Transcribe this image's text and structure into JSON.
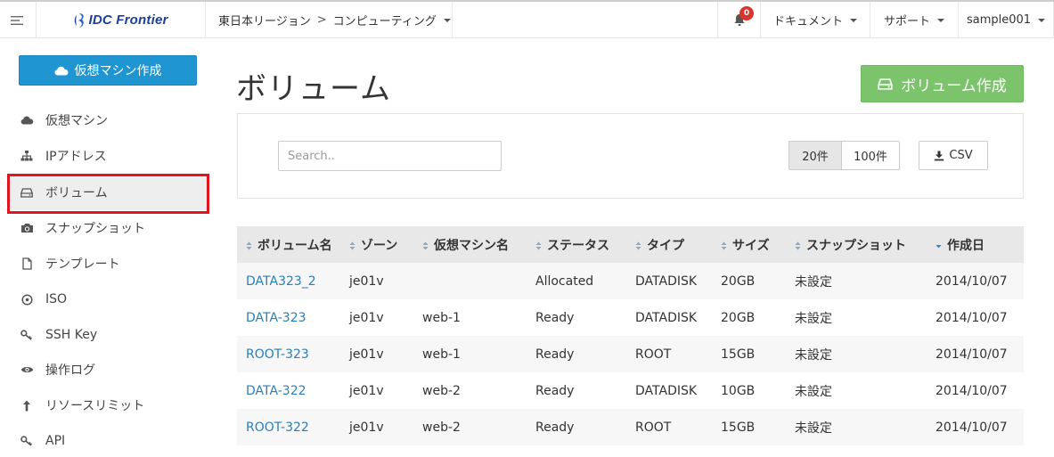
{
  "header": {
    "logo_text": "IDC Frontier",
    "region": "東日本リージョン",
    "breadcrumb_sep": ">",
    "service": "コンピューティング",
    "notification_count": "0",
    "documents": "ドキュメント",
    "support": "サポート",
    "user": "sample001"
  },
  "sidebar": {
    "create_vm_label": "仮想マシン作成",
    "items": [
      {
        "label": "仮想マシン",
        "icon": "cloud-icon"
      },
      {
        "label": "IPアドレス",
        "icon": "network-icon"
      },
      {
        "label": "ボリューム",
        "icon": "drive-icon"
      },
      {
        "label": "スナップショット",
        "icon": "camera-icon"
      },
      {
        "label": "テンプレート",
        "icon": "file-icon"
      },
      {
        "label": "ISO",
        "icon": "disc-icon"
      },
      {
        "label": "SSH Key",
        "icon": "key-icon"
      },
      {
        "label": "操作ログ",
        "icon": "eye-icon"
      },
      {
        "label": "リソースリミット",
        "icon": "upload-icon"
      },
      {
        "label": "API",
        "icon": "key-icon"
      }
    ],
    "active_index": 2
  },
  "main": {
    "title": "ボリューム",
    "create_volume_label": "ボリューム作成",
    "search_placeholder": "Search..",
    "page_size_20": "20件",
    "page_size_100": "100件",
    "csv_label": "CSV"
  },
  "table": {
    "headers": [
      "ボリューム名",
      "ゾーン",
      "仮想マシン名",
      "ステータス",
      "タイプ",
      "サイズ",
      "スナップショット",
      "作成日"
    ],
    "rows": [
      {
        "name": "DATA323_2",
        "zone": "je01v",
        "vm": "",
        "status": "Allocated",
        "type": "DATADISK",
        "size": "20GB",
        "snapshot": "未設定",
        "created": "2014/10/07"
      },
      {
        "name": "DATA-323",
        "zone": "je01v",
        "vm": "web-1",
        "status": "Ready",
        "type": "DATADISK",
        "size": "20GB",
        "snapshot": "未設定",
        "created": "2014/10/07"
      },
      {
        "name": "ROOT-323",
        "zone": "je01v",
        "vm": "web-1",
        "status": "Ready",
        "type": "ROOT",
        "size": "15GB",
        "snapshot": "未設定",
        "created": "2014/10/07"
      },
      {
        "name": "DATA-322",
        "zone": "je01v",
        "vm": "web-2",
        "status": "Ready",
        "type": "DATADISK",
        "size": "10GB",
        "snapshot": "未設定",
        "created": "2014/10/07"
      },
      {
        "name": "ROOT-322",
        "zone": "je01v",
        "vm": "web-2",
        "status": "Ready",
        "type": "ROOT",
        "size": "15GB",
        "snapshot": "未設定",
        "created": "2014/10/07"
      }
    ]
  },
  "colors": {
    "primary_blue": "#1f95d1",
    "create_green": "#7bc46c",
    "link_blue": "#2a7fb8",
    "ready_green": "#3c7a2b",
    "alloc_gray": "#aaaaaa",
    "highlight_red": "#e0151f",
    "badge_red": "#d9352f"
  }
}
